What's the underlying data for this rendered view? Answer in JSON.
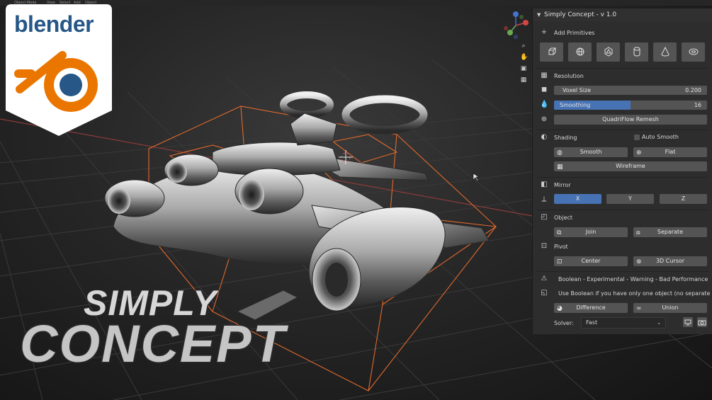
{
  "topbar": {
    "mode": "Object Mode",
    "menus": [
      "View",
      "Select",
      "Add",
      "Object"
    ]
  },
  "badge": {
    "brand": "blender"
  },
  "title": {
    "line1": "SIMPLY",
    "line2": "CONCEPT"
  },
  "colors": {
    "accent": "#4772b3",
    "panel": "#2d2d2d",
    "button": "#545454",
    "wire": "#e0692d",
    "logo_orange": "#ea7600",
    "logo_blue": "#265787"
  },
  "panel": {
    "title": "Simply Concept - v 1.0",
    "add_primitives": {
      "label": "Add Primitives",
      "items": [
        "cube-icon",
        "sphere-icon",
        "icosphere-icon",
        "cylinder-icon",
        "cone-icon",
        "torus-icon"
      ]
    },
    "resolution": {
      "label": "Resolution",
      "voxel": {
        "label": "Voxel Size",
        "value": "0.200"
      },
      "smoothing": {
        "label": "Smoothing",
        "value": "16",
        "fill": 0.5
      },
      "remesh": "QuadriFlow Remesh"
    },
    "shading": {
      "label": "Shading",
      "auto_smooth": "Auto Smooth",
      "smooth": "Smooth",
      "flat": "Flat",
      "wireframe": "Wireframe"
    },
    "mirror": {
      "label": "Mirror",
      "x": "X",
      "y": "Y",
      "z": "Z"
    },
    "object": {
      "label": "Object",
      "join": "Join",
      "separate": "Separate"
    },
    "pivot": {
      "label": "Pivot",
      "center": "Center",
      "cursor": "3D Cursor"
    },
    "boolean": {
      "warning": "Boolean - Experimental - Warning - Bad Performance",
      "note": "Use Boolean if you have only one object (no separate pa...",
      "difference": "Difference",
      "union": "Union",
      "solver_label": "Solver:",
      "solver_value": "Fast"
    }
  }
}
